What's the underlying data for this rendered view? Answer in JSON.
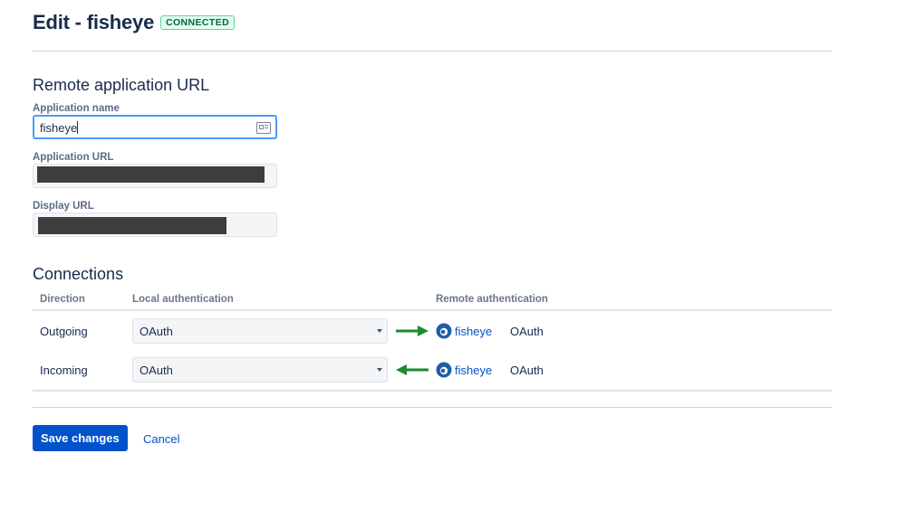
{
  "header": {
    "title": "Edit - fisheye",
    "status_badge": "CONNECTED"
  },
  "remote_app": {
    "section_title": "Remote application URL",
    "app_name": {
      "label": "Application name",
      "value": "fisheye"
    },
    "app_url": {
      "label": "Application URL",
      "value": ""
    },
    "display_url": {
      "label": "Display URL",
      "value": ""
    }
  },
  "connections": {
    "section_title": "Connections",
    "columns": [
      "Direction",
      "Local authentication",
      "Remote authentication"
    ],
    "rows": [
      {
        "direction": "Outgoing",
        "local_auth": "OAuth",
        "arrow": "right-arrow-icon",
        "remote_app": "fisheye",
        "remote_auth": "OAuth"
      },
      {
        "direction": "Incoming",
        "local_auth": "OAuth",
        "arrow": "left-arrow-icon",
        "remote_app": "fisheye",
        "remote_auth": "OAuth"
      }
    ]
  },
  "actions": {
    "save": "Save changes",
    "cancel": "Cancel"
  },
  "colors": {
    "primary": "#0052cc",
    "arrow_green": "#1e8a2f",
    "badge_green": "#006644",
    "focus_blue": "#4c9aff"
  }
}
